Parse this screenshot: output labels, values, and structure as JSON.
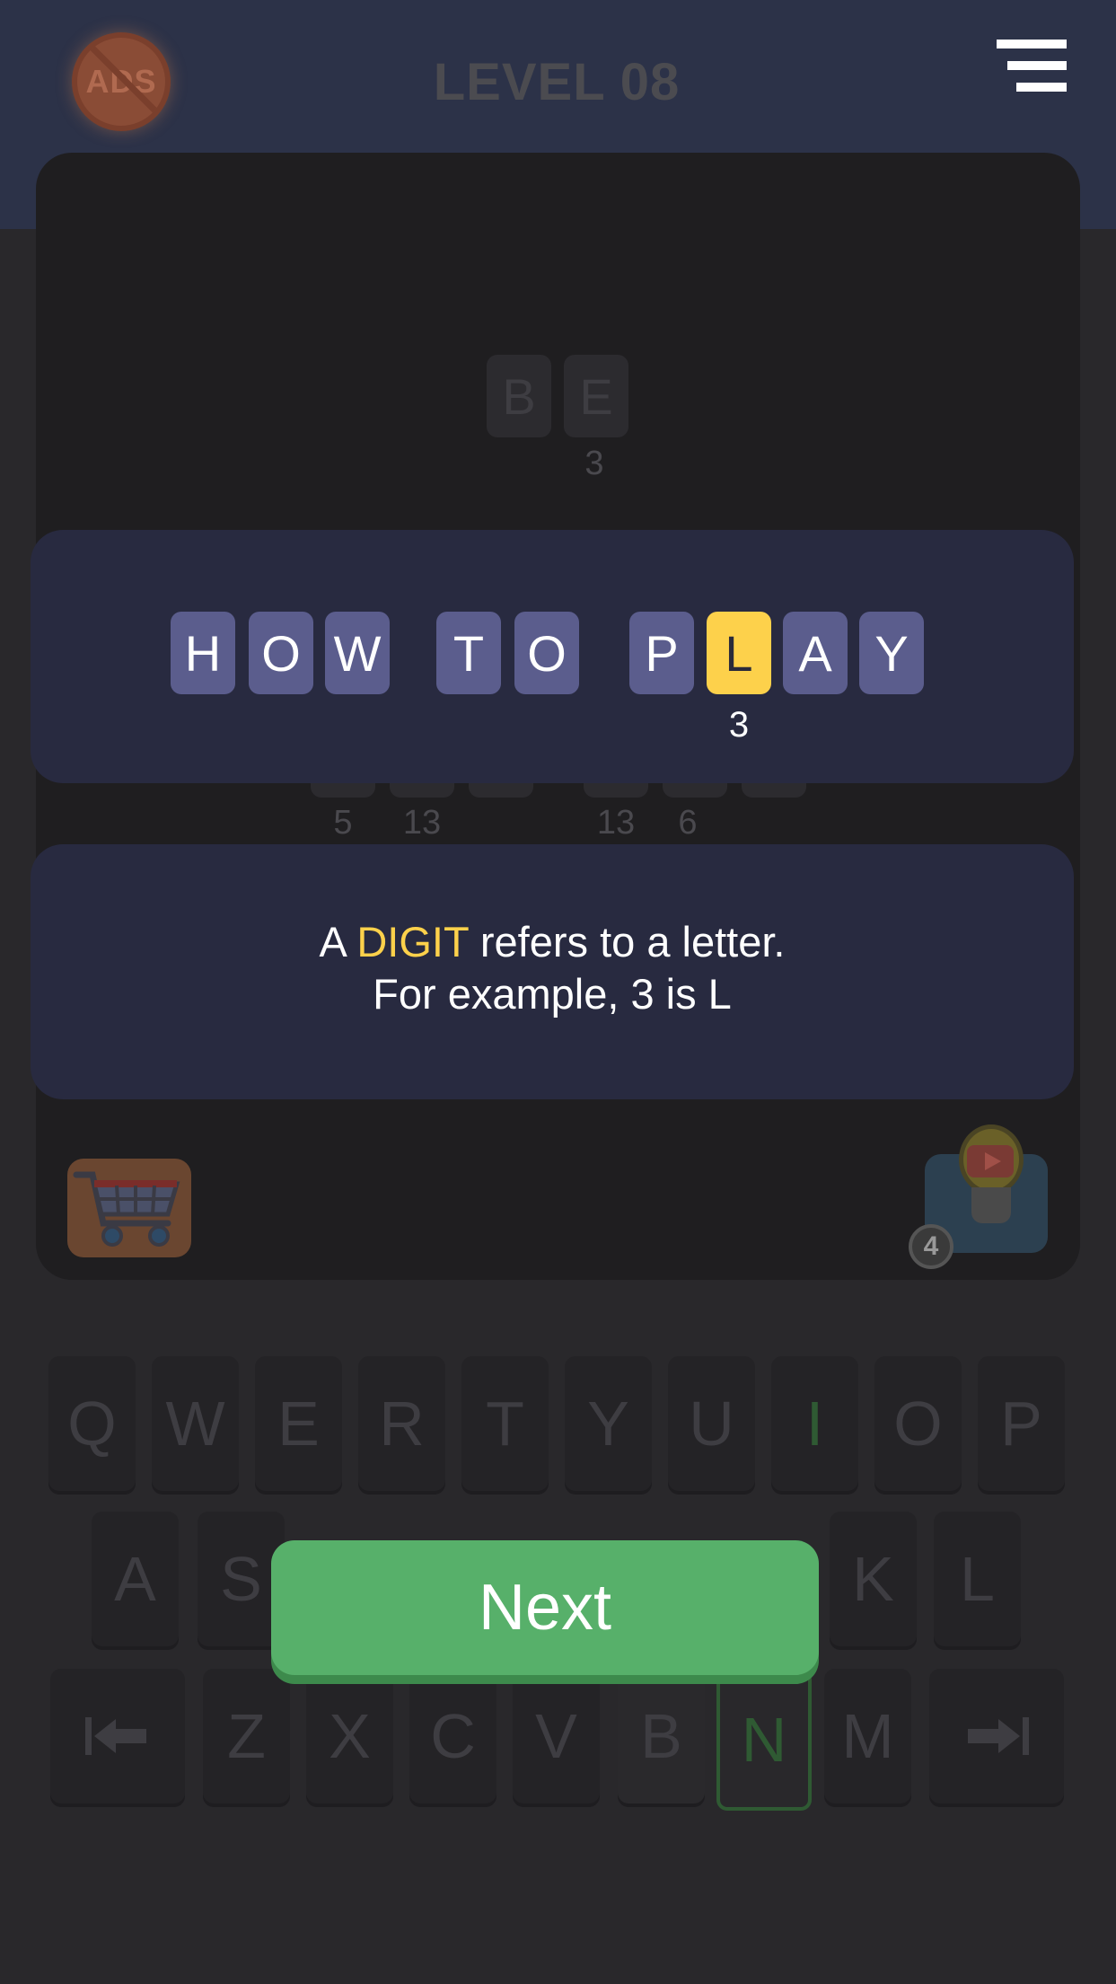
{
  "header": {
    "level_label": "LEVEL 08",
    "ads_label": "ADS"
  },
  "board": {
    "top_word": {
      "letters": [
        "B",
        "E"
      ],
      "number": "3"
    },
    "hidden_row_numbers": [
      "5",
      "13",
      "13",
      "6"
    ]
  },
  "how_to_play": {
    "words": [
      [
        "H",
        "O",
        "W"
      ],
      [
        "T",
        "O"
      ],
      [
        "P",
        "L",
        "A",
        "Y"
      ]
    ],
    "highlight_letter": "L",
    "highlight_number": "3"
  },
  "tip": {
    "prefix": "A ",
    "highlight": "DIGIT",
    "suffix": " refers to a letter.",
    "line2": "For example, 3 is L"
  },
  "hint": {
    "count": "4"
  },
  "keyboard": {
    "row1": [
      "Q",
      "W",
      "E",
      "R",
      "T",
      "Y",
      "U",
      "I",
      "O",
      "P"
    ],
    "row2": [
      "A",
      "S",
      "K",
      "L"
    ],
    "row3": [
      "Z",
      "X",
      "C",
      "V",
      "B",
      "N",
      "M"
    ]
  },
  "next_button": {
    "label": "Next"
  },
  "colors": {
    "accent_yellow": "#fdd14b",
    "next_green": "#57b06a",
    "tile_purple": "#5b5d8d"
  }
}
